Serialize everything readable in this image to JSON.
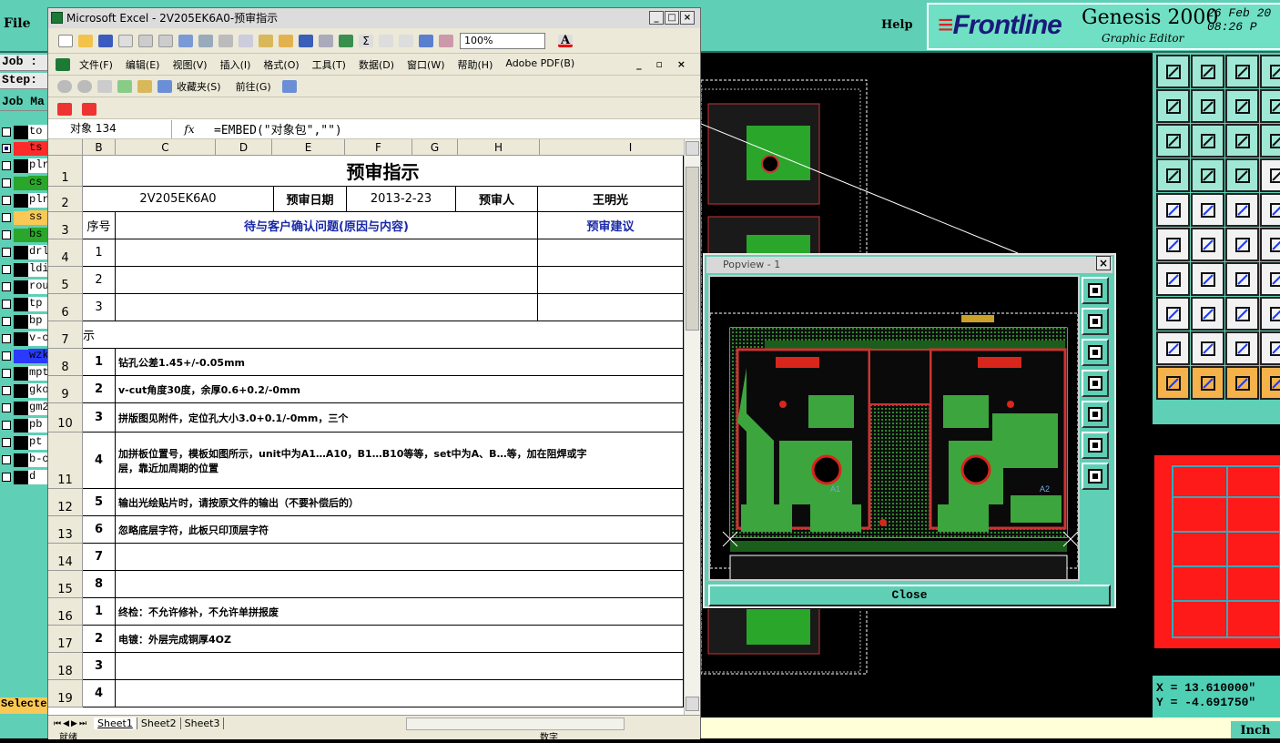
{
  "genesis": {
    "menu_file": "File",
    "menu_help": "Help",
    "logo": "Frontline",
    "product": "Genesis 2000",
    "subtitle": "Graphic Editor",
    "date_line1": "26 Feb 20",
    "date_line2": "08:26 P",
    "job_label": "Job :",
    "step_label": "Step:",
    "job_manager": "Job Ma",
    "layers": [
      {
        "name": "to",
        "color": "#000000",
        "checked": false
      },
      {
        "name": "ts",
        "color": "#ff2a2a",
        "checked": true
      },
      {
        "name": "plr",
        "color": "#000000",
        "checked": false
      },
      {
        "name": "cs",
        "color": "#2aa62a",
        "checked": false
      },
      {
        "name": "plr",
        "color": "#000000",
        "checked": false
      },
      {
        "name": "ss",
        "color": "#fac854",
        "checked": false
      },
      {
        "name": "bs",
        "color": "#2aa62a",
        "checked": false
      },
      {
        "name": "drl",
        "color": "#000000",
        "checked": false
      },
      {
        "name": "ldi",
        "color": "#000000",
        "checked": false
      },
      {
        "name": "rou",
        "color": "#000000",
        "checked": false
      },
      {
        "name": "tp",
        "color": "#000000",
        "checked": false
      },
      {
        "name": "bp",
        "color": "#000000",
        "checked": false
      },
      {
        "name": "v-c",
        "color": "#000000",
        "checked": false
      },
      {
        "name": "wzk",
        "color": "#2a3aff",
        "checked": false
      },
      {
        "name": "mpt",
        "color": "#000000",
        "checked": false
      },
      {
        "name": "gko",
        "color": "#000000",
        "checked": false
      },
      {
        "name": "gm2",
        "color": "#000000",
        "checked": false
      },
      {
        "name": "pb",
        "color": "#000000",
        "checked": false
      },
      {
        "name": "pt",
        "color": "#000000",
        "checked": false
      },
      {
        "name": "b-c",
        "color": "#000000",
        "checked": false
      },
      {
        "name": "d",
        "color": "#000000",
        "checked": false
      }
    ],
    "selected_label": "Selected",
    "coord_x": "X =  13.610000\"",
    "coord_y": "Y =  -4.691750\"",
    "units": "Inch"
  },
  "popview": {
    "title": "Popview - 1",
    "close_label": "Close",
    "board_labels": [
      "A1",
      "A2"
    ]
  },
  "excel": {
    "title": "Microsoft Excel - 2V205EK6A0-预审指示",
    "menus": [
      "文件(F)",
      "编辑(E)",
      "视图(V)",
      "插入(I)",
      "格式(O)",
      "工具(T)",
      "数据(D)",
      "窗口(W)",
      "帮助(H)",
      "Adobe PDF(B)"
    ],
    "zoom": "100%",
    "favorites": "收藏夹(S)",
    "goto": "前往(G)",
    "name_box": "对象 134",
    "fx": "fx",
    "formula": "=EMBED(\"对象包\",\"\")",
    "columns": [
      "B",
      "C",
      "D",
      "E",
      "F",
      "G",
      "H",
      "I"
    ],
    "sheet_title": "预审指示",
    "part_no": "2V205EK6A0",
    "review_date_label": "预审日期",
    "review_date": "2013-2-23",
    "reviewer_label": "预审人",
    "reviewer": "王明光",
    "seq_header": "序号",
    "issue_header": "待与客户确认问题(原因与内容)",
    "advice_header": "预审建议",
    "instr_header": "示",
    "rows": [
      {
        "rn": "1"
      },
      {
        "rn": "2"
      },
      {
        "rn": "3"
      },
      {
        "rn": "4",
        "seq": "1"
      },
      {
        "rn": "5",
        "seq": "2"
      },
      {
        "rn": "6",
        "seq": "3"
      },
      {
        "rn": "7"
      },
      {
        "rn": "8",
        "seq": "1",
        "text": "钻孔公差1.45+/-0.05mm"
      },
      {
        "rn": "9",
        "seq": "2",
        "text": "v-cut角度30度，余厚0.6+0.2/-0mm"
      },
      {
        "rn": "10",
        "seq": "3",
        "text": "拼版图见附件，定位孔大小3.0+0.1/-0mm，三个"
      },
      {
        "rn": "11",
        "seq": "4",
        "text": "加拼板位置号，模板如图所示，unit中为A1…A10，B1…B10等等，set中为A、B…等，加在阻焊或字",
        "text2": "层，靠近加周期的位置"
      },
      {
        "rn": "12",
        "seq": "5",
        "text": "输出光绘贴片时，请按原文件的输出（不要补偿后的）"
      },
      {
        "rn": "13",
        "seq": "6",
        "text": "忽略底层字符，此板只印顶层字符"
      },
      {
        "rn": "14",
        "seq": "7"
      },
      {
        "rn": "15",
        "seq": "8"
      },
      {
        "rn": "16",
        "seq": "1",
        "text": "终检：不允许修补，不允许单拼报废"
      },
      {
        "rn": "17",
        "seq": "2",
        "text": "电镀：外层完成铜厚4OZ"
      },
      {
        "rn": "18",
        "seq": "3"
      },
      {
        "rn": "19",
        "seq": "4"
      }
    ],
    "sheets": [
      "Sheet1",
      "Sheet2",
      "Sheet3"
    ],
    "status_ready": "就绪",
    "status_num": "数字"
  }
}
